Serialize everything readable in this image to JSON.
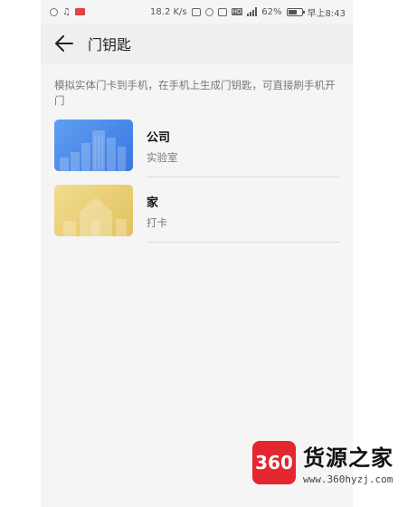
{
  "status_bar": {
    "speed": "18.2 K/s",
    "battery": "62%",
    "battery_level": 0.62,
    "time": "早上8:43",
    "icons": [
      "sync-icon",
      "music-icon",
      "card-icon",
      "nfc-icon",
      "alarm-icon",
      "vibrate-icon",
      "hd-icon",
      "signal-icon",
      "battery-icon"
    ]
  },
  "header": {
    "title": "门钥匙",
    "back_icon": "arrow-left-icon"
  },
  "description": "模拟实体门卡到手机，在手机上生成门钥匙，可直接刷手机开门",
  "keys": [
    {
      "name": "公司",
      "subtitle": "实验室",
      "thumb_color": "#4a8ae8",
      "thumb_icon": "city-buildings-icon"
    },
    {
      "name": "家",
      "subtitle": "打卡",
      "thumb_color": "#e9cf77",
      "thumb_icon": "house-icon"
    }
  ],
  "watermark": {
    "badge": "360",
    "name": "货源之家",
    "url": "www.360hyzj.com",
    "color": "#e3262f"
  }
}
